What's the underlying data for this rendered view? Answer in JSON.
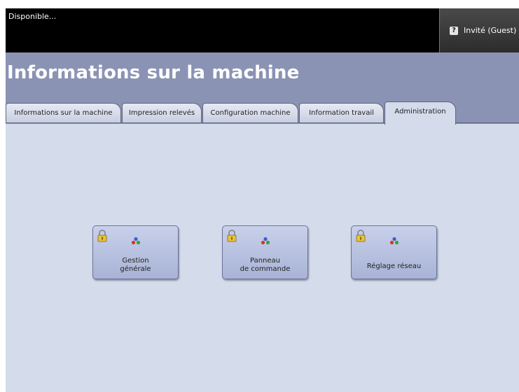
{
  "status": {
    "text": "Disponible..."
  },
  "user": {
    "label": "Invité (Guest)",
    "icon": "key-icon"
  },
  "page": {
    "title": "Informations sur la machine"
  },
  "tabs": [
    {
      "label": "Informations sur la machine",
      "active": false
    },
    {
      "label": "Impression relevés",
      "active": false
    },
    {
      "label": "Configuration machine",
      "active": false
    },
    {
      "label": "Information travail",
      "active": false
    },
    {
      "label": "Administration",
      "active": true
    }
  ],
  "actions": [
    {
      "label_line1": "Gestion",
      "label_line2": "générale",
      "icons": [
        "lock-icon",
        "services-icon"
      ]
    },
    {
      "label_line1": "Panneau",
      "label_line2": "de commande",
      "icons": [
        "lock-icon",
        "services-icon"
      ]
    },
    {
      "label_line1": "Réglage réseau",
      "label_line2": "",
      "icons": [
        "lock-icon",
        "services-icon"
      ]
    }
  ],
  "colors": {
    "status_bar": "#000000",
    "title_band": "#8b93b4",
    "content_bg": "#d4dbea",
    "button_face": "#b8c1e0"
  }
}
